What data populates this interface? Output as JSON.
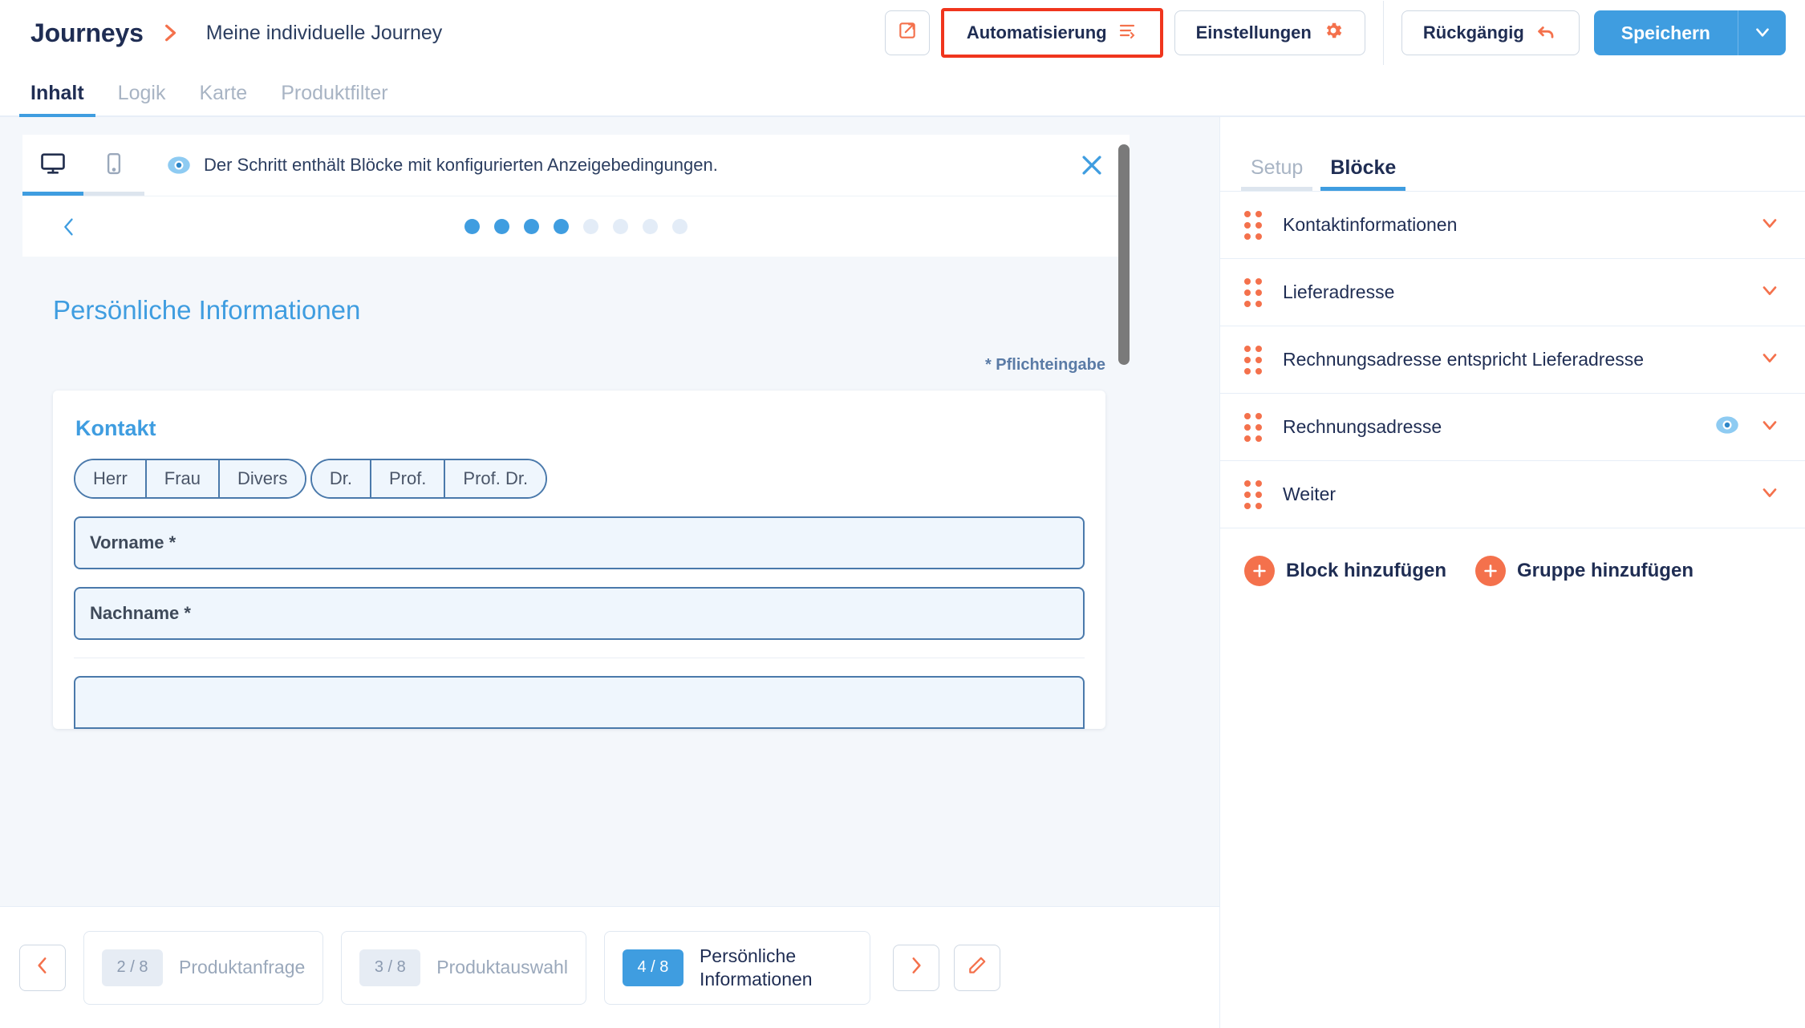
{
  "header": {
    "brand": "Journeys",
    "breadcrumb_chevron_icon": "chevron-right-icon",
    "journey_name": "Meine individuelle Journey",
    "preview_button_icon": "external-link-icon",
    "automation_label": "Automatisierung",
    "automation_icon": "automation-list-icon",
    "settings_label": "Einstellungen",
    "settings_icon": "gear-icon",
    "undo_label": "Rückgängig",
    "undo_icon": "undo-arrow-icon",
    "save_label": "Speichern",
    "save_caret_icon": "chevron-down-icon",
    "highlight_color": "#f0351d",
    "accent_blue": "#3f9de0",
    "accent_orange": "#f4714c"
  },
  "tabs": [
    {
      "label": "Inhalt",
      "active": true
    },
    {
      "label": "Logik",
      "active": false
    },
    {
      "label": "Karte",
      "active": false
    },
    {
      "label": "Produktfilter",
      "active": false
    }
  ],
  "preview": {
    "device_toggle": [
      {
        "icon": "desktop-icon",
        "active": true
      },
      {
        "icon": "mobile-icon",
        "active": false
      }
    ],
    "notice": {
      "icon": "eye-icon",
      "text": "Der Schritt enthält Blöcke mit konfigurierten Anzeigebedingungen.",
      "close_icon": "close-icon"
    },
    "stepper": {
      "back_icon": "chevron-left-icon",
      "total_dots": 8,
      "filled_dots": 4
    },
    "form": {
      "title": "Persönliche Informationen",
      "required_note": "* Pflichteingabe",
      "card_title": "Kontakt",
      "salutation_options": [
        "Herr",
        "Frau",
        "Divers"
      ],
      "title_options": [
        "Dr.",
        "Prof.",
        "Prof. Dr."
      ],
      "fields": [
        {
          "label": "Vorname *"
        },
        {
          "label": "Nachname *"
        },
        {
          "label": ""
        }
      ]
    }
  },
  "panel": {
    "tabs": [
      {
        "label": "Setup",
        "active": false
      },
      {
        "label": "Blöcke",
        "active": true
      }
    ],
    "blocks": [
      {
        "label": "Kontaktinformationen",
        "grip_icon": "drag-handle-icon",
        "chevron_icon": "chevron-down-icon",
        "has_visibility": false
      },
      {
        "label": "Lieferadresse",
        "grip_icon": "drag-handle-icon",
        "chevron_icon": "chevron-down-icon",
        "has_visibility": false
      },
      {
        "label": "Rechnungsadresse entspricht Lieferadresse",
        "grip_icon": "drag-handle-icon",
        "chevron_icon": "chevron-down-icon",
        "has_visibility": false
      },
      {
        "label": "Rechnungsadresse",
        "grip_icon": "drag-handle-icon",
        "chevron_icon": "chevron-down-icon",
        "has_visibility": true,
        "visibility_icon": "eye-icon"
      },
      {
        "label": "Weiter",
        "grip_icon": "drag-handle-icon",
        "chevron_icon": "chevron-down-icon",
        "has_visibility": false
      }
    ],
    "add_block_label": "Block hinzufügen",
    "add_group_label": "Gruppe hinzufügen",
    "add_icon": "plus-circle-icon"
  },
  "bottom": {
    "prev_icon": "chevron-left-icon",
    "next_icon": "chevron-right-icon",
    "edit_icon": "pencil-icon",
    "steps": [
      {
        "badge": "2 / 8",
        "label": "Produktanfrage",
        "active": false
      },
      {
        "badge": "3 / 8",
        "label": "Produktauswahl",
        "active": false
      },
      {
        "badge": "4 / 8",
        "label": "Persönliche Informationen",
        "active": true
      }
    ]
  }
}
